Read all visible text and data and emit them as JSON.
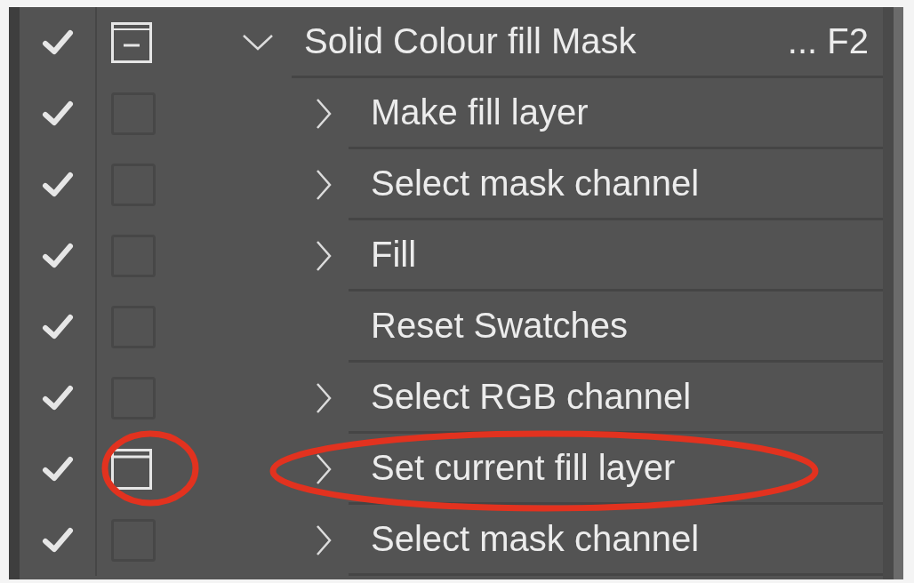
{
  "action": {
    "name": "Solid Colour fill Mask",
    "shortcut": "... F2",
    "checked": true,
    "dialog": true,
    "dialog_mixed": true,
    "expanded": true,
    "circled": false,
    "children": [
      {
        "name": "Make fill layer",
        "checked": true,
        "dialog": false,
        "expandable": true,
        "circled": false
      },
      {
        "name": "Select mask channel",
        "checked": true,
        "dialog": false,
        "expandable": true,
        "circled": false
      },
      {
        "name": "Fill",
        "checked": true,
        "dialog": false,
        "expandable": true,
        "circled": false
      },
      {
        "name": "Reset Swatches",
        "checked": true,
        "dialog": false,
        "expandable": false,
        "circled": false
      },
      {
        "name": "Select RGB channel",
        "checked": true,
        "dialog": false,
        "expandable": true,
        "circled": false
      },
      {
        "name": "Set current fill layer",
        "checked": true,
        "dialog": true,
        "expandable": true,
        "circled": true
      },
      {
        "name": "Select mask channel",
        "checked": true,
        "dialog": false,
        "expandable": true,
        "circled": false
      }
    ]
  }
}
